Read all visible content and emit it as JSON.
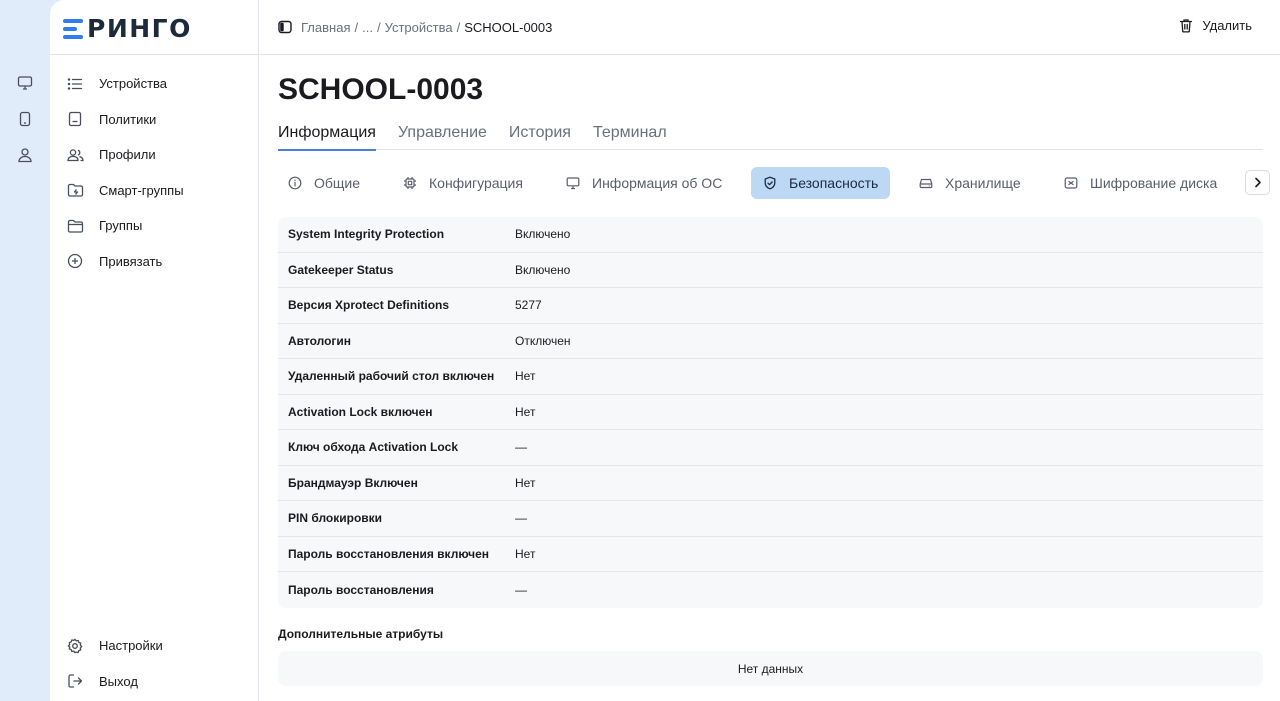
{
  "app": {
    "logo_text": "РИНГО",
    "brand_color": "#2f7cf0"
  },
  "rail": [
    "monitor-icon",
    "phone-icon",
    "user-icon"
  ],
  "sidebar": {
    "items": [
      {
        "label": "Устройства",
        "icon": "list-icon"
      },
      {
        "label": "Политики",
        "icon": "document-icon"
      },
      {
        "label": "Профили",
        "icon": "users-icon"
      },
      {
        "label": "Смарт-группы",
        "icon": "smart-folder-icon"
      },
      {
        "label": "Группы",
        "icon": "folder-icon"
      },
      {
        "label": "Привязать",
        "icon": "plus-circle-icon"
      }
    ],
    "bottom": [
      {
        "label": "Настройки",
        "icon": "gear-icon"
      },
      {
        "label": "Выход",
        "icon": "logout-icon"
      }
    ]
  },
  "topbar": {
    "breadcrumb": [
      "Главная",
      "...",
      "Устройства",
      "SCHOOL-0003"
    ],
    "separator": "/",
    "delete_label": "Удалить"
  },
  "page": {
    "title": "SCHOOL-0003",
    "tabs": [
      "Информация",
      "Управление",
      "История",
      "Терминал"
    ],
    "active_tab": 0,
    "subtabs": [
      {
        "label": "Общие",
        "icon": "info-icon"
      },
      {
        "label": "Конфигурация",
        "icon": "chip-icon"
      },
      {
        "label": "Информация об ОС",
        "icon": "monitor-icon"
      },
      {
        "label": "Безопасность",
        "icon": "shield-icon"
      },
      {
        "label": "Хранилище",
        "icon": "drive-icon"
      },
      {
        "label": "Шифрование диска",
        "icon": "lock-box-icon"
      }
    ],
    "active_subtab": 3,
    "security_rows": [
      {
        "key": "System Integrity Protection",
        "value": "Включено"
      },
      {
        "key": "Gatekeeper Status",
        "value": "Включено"
      },
      {
        "key": "Версия Xprotect Definitions",
        "value": "5277"
      },
      {
        "key": "Автологин",
        "value": "Отключен"
      },
      {
        "key": "Удаленный рабочий стол включен",
        "value": "Нет"
      },
      {
        "key": "Activation Lock включен",
        "value": "Нет"
      },
      {
        "key": "Ключ обхода Activation Lock",
        "value": "—"
      },
      {
        "key": "Брандмауэр Включен",
        "value": "Нет"
      },
      {
        "key": "PIN блокировки",
        "value": "—"
      },
      {
        "key": "Пароль восстановления включен",
        "value": "Нет"
      },
      {
        "key": "Пароль восстановления",
        "value": "—"
      }
    ],
    "extra_title": "Дополнительные атрибуты",
    "extra_empty": "Нет данных"
  }
}
